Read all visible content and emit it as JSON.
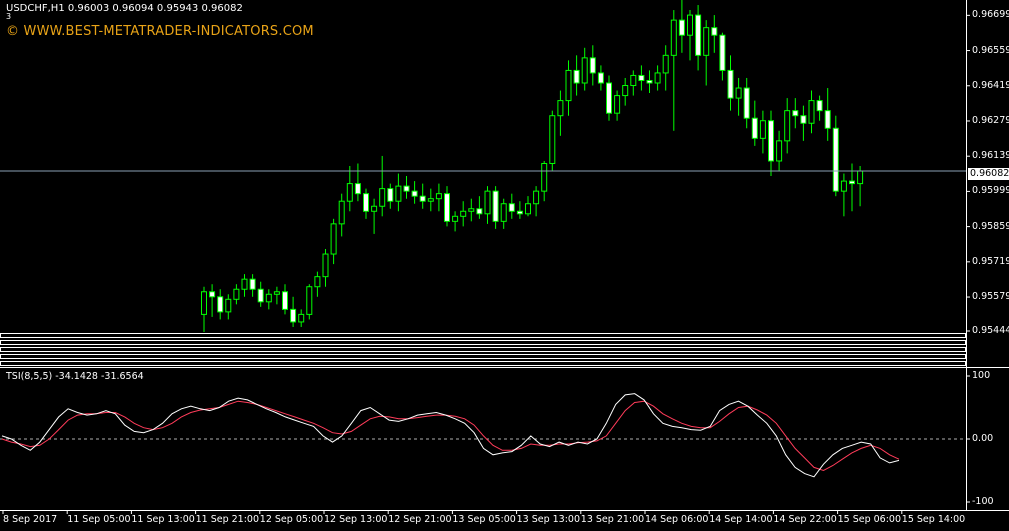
{
  "symbol_header": "USDCHF,H1  0.96003 0.96094 0.95943 0.96082",
  "header_small": "3",
  "watermark": "© WWW.BEST-METATRADER-INDICATORS.COM",
  "indicator_header": "TSI(8,5,5) -34.1428 -31.6564",
  "price_axis": [
    "0.96699",
    "0.96559",
    "0.96419",
    "0.96279",
    "0.96139",
    "0.95999",
    "0.95859",
    "0.95719",
    "0.95579",
    "0.95444"
  ],
  "current_price": "0.96082",
  "indicator_axis": [
    "100",
    "0.00",
    "-100"
  ],
  "time_axis": [
    "8 Sep 2017",
    "11 Sep 05:00",
    "11 Sep 13:00",
    "11 Sep 21:00",
    "12 Sep 05:00",
    "12 Sep 13:00",
    "12 Sep 21:00",
    "13 Sep 05:00",
    "13 Sep 13:00",
    "13 Sep 21:00",
    "14 Sep 06:00",
    "14 Sep 14:00",
    "14 Sep 22:00",
    "15 Sep 06:00",
    "15 Sep 14:00"
  ],
  "colors": {
    "background": "#000000",
    "candle": "#00ff00",
    "candle_bull_body": "#000000",
    "candle_bear_body": "#ffffff",
    "tsi_line": "#ffffff",
    "signal_line": "#ff3c5a",
    "grid_level": "#b0b0b0"
  },
  "chart_data": [
    {
      "type": "candlestick",
      "symbol": "USDCHF",
      "timeframe": "H1",
      "ylim": [
        0.9544,
        0.9676
      ],
      "candles": [
        [
          0.9551,
          0.9562,
          0.9544,
          0.956
        ],
        [
          0.956,
          0.9563,
          0.955,
          0.9558
        ],
        [
          0.9558,
          0.9561,
          0.9549,
          0.9552
        ],
        [
          0.9552,
          0.9559,
          0.9549,
          0.9557
        ],
        [
          0.9557,
          0.9563,
          0.9555,
          0.9561
        ],
        [
          0.9561,
          0.9567,
          0.9558,
          0.9565
        ],
        [
          0.9565,
          0.9567,
          0.9558,
          0.9561
        ],
        [
          0.9561,
          0.9564,
          0.9554,
          0.9556
        ],
        [
          0.9556,
          0.9561,
          0.9553,
          0.9559
        ],
        [
          0.9559,
          0.9562,
          0.9555,
          0.956
        ],
        [
          0.956,
          0.9563,
          0.9551,
          0.9553
        ],
        [
          0.9553,
          0.9558,
          0.9546,
          0.9548
        ],
        [
          0.9548,
          0.9553,
          0.9546,
          0.9551
        ],
        [
          0.9551,
          0.9563,
          0.9549,
          0.9562
        ],
        [
          0.9562,
          0.9568,
          0.9558,
          0.9566
        ],
        [
          0.9566,
          0.9577,
          0.9562,
          0.9575
        ],
        [
          0.9575,
          0.9589,
          0.9571,
          0.9587
        ],
        [
          0.9587,
          0.9599,
          0.9582,
          0.9596
        ],
        [
          0.9596,
          0.961,
          0.9592,
          0.9603
        ],
        [
          0.9603,
          0.9611,
          0.9596,
          0.9599
        ],
        [
          0.9599,
          0.9601,
          0.9589,
          0.9592
        ],
        [
          0.9592,
          0.9597,
          0.9583,
          0.9594
        ],
        [
          0.9594,
          0.9614,
          0.959,
          0.9601
        ],
        [
          0.9601,
          0.9603,
          0.9593,
          0.9596
        ],
        [
          0.9596,
          0.9607,
          0.9592,
          0.9602
        ],
        [
          0.9602,
          0.9606,
          0.9597,
          0.96
        ],
        [
          0.96,
          0.9604,
          0.9595,
          0.9598
        ],
        [
          0.9598,
          0.9603,
          0.9593,
          0.9596
        ],
        [
          0.9596,
          0.9601,
          0.9592,
          0.9597
        ],
        [
          0.9597,
          0.9603,
          0.9592,
          0.9599
        ],
        [
          0.9599,
          0.9602,
          0.9586,
          0.9588
        ],
        [
          0.9588,
          0.9592,
          0.9584,
          0.959
        ],
        [
          0.959,
          0.9596,
          0.9586,
          0.9592
        ],
        [
          0.9592,
          0.9597,
          0.9588,
          0.9593
        ],
        [
          0.9593,
          0.9598,
          0.9589,
          0.9591
        ],
        [
          0.9591,
          0.9602,
          0.9587,
          0.96
        ],
        [
          0.96,
          0.9602,
          0.9585,
          0.9588
        ],
        [
          0.9588,
          0.9597,
          0.9585,
          0.9595
        ],
        [
          0.9595,
          0.9599,
          0.9589,
          0.9592
        ],
        [
          0.9592,
          0.9596,
          0.9589,
          0.9591
        ],
        [
          0.9591,
          0.9598,
          0.959,
          0.9595
        ],
        [
          0.9595,
          0.9602,
          0.959,
          0.96
        ],
        [
          0.96,
          0.9612,
          0.9596,
          0.9611
        ],
        [
          0.9611,
          0.9632,
          0.9608,
          0.963
        ],
        [
          0.963,
          0.964,
          0.9622,
          0.9636
        ],
        [
          0.9636,
          0.9652,
          0.963,
          0.9648
        ],
        [
          0.9648,
          0.9654,
          0.9638,
          0.9643
        ],
        [
          0.9643,
          0.9657,
          0.964,
          0.9653
        ],
        [
          0.9653,
          0.9658,
          0.9642,
          0.9647
        ],
        [
          0.9647,
          0.965,
          0.964,
          0.9643
        ],
        [
          0.9643,
          0.9646,
          0.9628,
          0.9631
        ],
        [
          0.9631,
          0.964,
          0.9628,
          0.9638
        ],
        [
          0.9638,
          0.9645,
          0.9634,
          0.9642
        ],
        [
          0.9642,
          0.9648,
          0.9638,
          0.9646
        ],
        [
          0.9646,
          0.965,
          0.964,
          0.9644
        ],
        [
          0.9644,
          0.9648,
          0.9639,
          0.9643
        ],
        [
          0.9643,
          0.965,
          0.964,
          0.9647
        ],
        [
          0.9647,
          0.9658,
          0.964,
          0.9654
        ],
        [
          0.9654,
          0.9672,
          0.9624,
          0.9668
        ],
        [
          0.9668,
          0.9676,
          0.9655,
          0.9662
        ],
        [
          0.9662,
          0.9672,
          0.9652,
          0.967
        ],
        [
          0.967,
          0.9674,
          0.9648,
          0.9654
        ],
        [
          0.9654,
          0.9668,
          0.9642,
          0.9665
        ],
        [
          0.9665,
          0.967,
          0.9655,
          0.9662
        ],
        [
          0.9662,
          0.9663,
          0.9644,
          0.9648
        ],
        [
          0.9648,
          0.9654,
          0.9632,
          0.9637
        ],
        [
          0.9637,
          0.9645,
          0.963,
          0.9641
        ],
        [
          0.9641,
          0.9645,
          0.9625,
          0.9629
        ],
        [
          0.9629,
          0.9636,
          0.9618,
          0.9621
        ],
        [
          0.9621,
          0.9632,
          0.9615,
          0.9628
        ],
        [
          0.9628,
          0.9632,
          0.9606,
          0.9612
        ],
        [
          0.9612,
          0.9624,
          0.9608,
          0.962
        ],
        [
          0.962,
          0.9637,
          0.9615,
          0.9632
        ],
        [
          0.9632,
          0.9637,
          0.9625,
          0.963
        ],
        [
          0.963,
          0.9634,
          0.962,
          0.9627
        ],
        [
          0.9627,
          0.964,
          0.9623,
          0.9636
        ],
        [
          0.9636,
          0.9638,
          0.9628,
          0.9632
        ],
        [
          0.9632,
          0.9641,
          0.962,
          0.9625
        ],
        [
          0.9625,
          0.963,
          0.9598,
          0.96
        ],
        [
          0.96,
          0.9607,
          0.959,
          0.9604
        ],
        [
          0.9604,
          0.9611,
          0.9592,
          0.9603
        ],
        [
          0.9603,
          0.961,
          0.9594,
          0.9608
        ]
      ]
    },
    {
      "type": "line",
      "name": "TSI(8,5,5)",
      "ylim": [
        -100,
        100
      ],
      "series": [
        {
          "values": [
            5,
            0,
            -10,
            -18,
            -5,
            15,
            35,
            48,
            42,
            38,
            40,
            45,
            40,
            22,
            12,
            10,
            15,
            25,
            40,
            48,
            52,
            48,
            45,
            50,
            60,
            65,
            62,
            55,
            48,
            42,
            35,
            30,
            25,
            20,
            5,
            -5,
            5,
            25,
            45,
            50,
            40,
            30,
            28,
            32,
            38,
            40,
            42,
            38,
            32,
            25,
            10,
            -15,
            -25,
            -22,
            -20,
            -10,
            5,
            -8,
            -12,
            -5,
            -10,
            -5,
            -8,
            0,
            25,
            55,
            70,
            72,
            62,
            40,
            25,
            20,
            18,
            15,
            14,
            20,
            45,
            55,
            60,
            52,
            38,
            25,
            5,
            -25,
            -45,
            -55,
            -60,
            -40,
            -25,
            -15,
            -10,
            -5,
            -8,
            -30,
            -38,
            -34
          ]
        },
        {
          "values": [
            0,
            -5,
            -8,
            -12,
            -10,
            0,
            15,
            30,
            38,
            40,
            40,
            42,
            42,
            35,
            25,
            18,
            15,
            18,
            25,
            35,
            42,
            46,
            48,
            50,
            55,
            60,
            58,
            55,
            50,
            45,
            40,
            35,
            30,
            25,
            18,
            10,
            8,
            12,
            22,
            32,
            36,
            35,
            32,
            32,
            34,
            36,
            38,
            38,
            36,
            32,
            22,
            5,
            -10,
            -18,
            -18,
            -15,
            -8,
            -10,
            -10,
            -8,
            -8,
            -6,
            -5,
            -3,
            5,
            25,
            45,
            58,
            60,
            52,
            40,
            32,
            25,
            20,
            18,
            18,
            28,
            40,
            50,
            52,
            46,
            38,
            25,
            5,
            -15,
            -30,
            -45,
            -50,
            -42,
            -32,
            -22,
            -15,
            -10,
            -15,
            -25,
            -32
          ]
        }
      ]
    }
  ]
}
